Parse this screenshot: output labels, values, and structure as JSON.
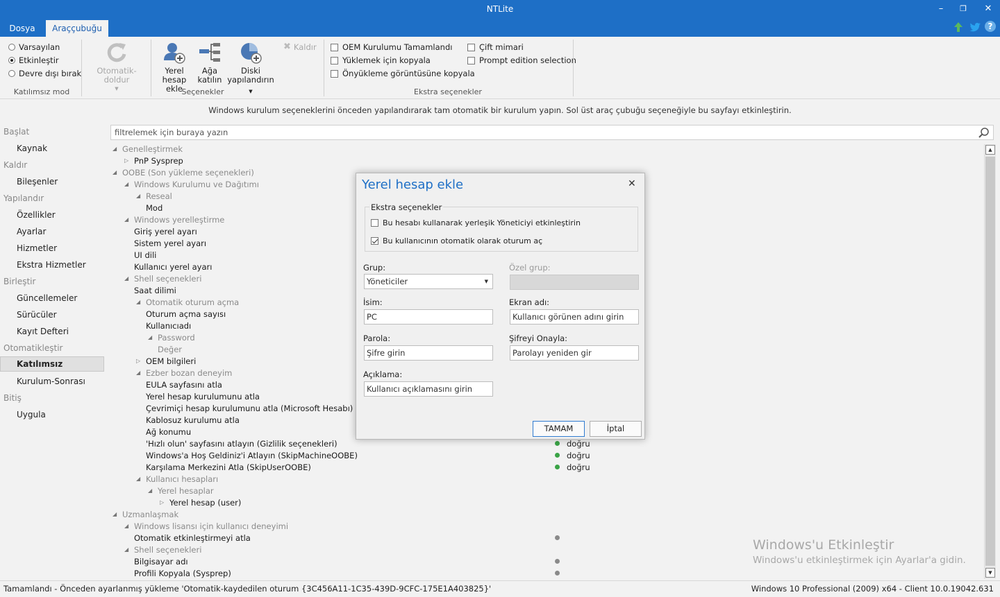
{
  "window": {
    "title": "NTLite",
    "min": "–",
    "max": "❐",
    "close": "✕"
  },
  "menu": {
    "tabs": [
      "Dosya",
      "Araççubuğu"
    ]
  },
  "ribbon": {
    "mode": {
      "options": [
        "Varsayılan",
        "Etkinleştir",
        "Devre dışı bırak"
      ],
      "selected": 1,
      "label": "Katılımsız mod"
    },
    "options": {
      "autorefresh": "Otomatik-doldur",
      "add_local_account": "Yerel hesap ekle",
      "add_local_account_l1": "Yerel",
      "add_local_account_l2": "hesap ekle",
      "join_network_l1": "Ağa",
      "join_network_l2": "katılın",
      "configure_disk_l1": "Diski",
      "configure_disk_l2": "yapılandırın",
      "remove": "Kaldır",
      "label": "Seçenekler"
    },
    "extra": {
      "items": [
        {
          "label": "OEM Kurulumu Tamamlandı",
          "checked": false
        },
        {
          "label": "Yüklemek için kopyala",
          "checked": false
        },
        {
          "label": "Önyükleme görüntüsüne kopyala",
          "checked": false
        },
        {
          "label": "Çift mimari",
          "checked": false
        },
        {
          "label": "Prompt edition selection",
          "checked": false
        }
      ],
      "label": "Ekstra seçenekler"
    },
    "right_icons": [
      "up-arrow-icon",
      "twitter-icon",
      "help-icon"
    ],
    "help": "?"
  },
  "info": "Windows kurulum seçeneklerini önceden yapılandırarak tam otomatik bir kurulum yapın. Sol üst araç çubuğu seçeneğiyle bu sayfayı etkinleştirin.",
  "sidebar": {
    "sections": [
      {
        "header": "Başlat",
        "items": [
          "Kaynak"
        ]
      },
      {
        "header": "Kaldır",
        "items": [
          "Bileşenler"
        ]
      },
      {
        "header": "Yapılandır",
        "items": [
          "Özellikler",
          "Ayarlar",
          "Hizmetler",
          "Ekstra Hizmetler"
        ]
      },
      {
        "header": "Birleştir",
        "items": [
          "Güncellemeler",
          "Sürücüler",
          "Kayıt Defteri"
        ]
      },
      {
        "header": "Otomatikleştir",
        "items": [
          "Katılımsız",
          "Kurulum-Sonrası"
        ]
      },
      {
        "header": "Bitiş",
        "items": [
          "Uygula"
        ]
      }
    ],
    "active": "Katılımsız"
  },
  "filter": {
    "placeholder": "filtrelemek için buraya yazın"
  },
  "tree": [
    {
      "label": "Genelleştirmek",
      "level": 0,
      "group": true,
      "arrow": "◢"
    },
    {
      "label": "PnP Sysprep",
      "level": 1,
      "group": false,
      "arrow": "▷"
    },
    {
      "label": "OOBE (Son yükleme seçenekleri)",
      "level": 0,
      "group": true,
      "arrow": "◢"
    },
    {
      "label": "Windows Kurulumu ve Dağıtımı",
      "level": 1,
      "group": true,
      "arrow": "◢"
    },
    {
      "label": "Reseal",
      "level": 2,
      "group": true,
      "arrow": "◢"
    },
    {
      "label": "Mod",
      "level": 2,
      "group": false
    },
    {
      "label": "Windows yerelleştirme",
      "level": 1,
      "group": true,
      "arrow": "◢"
    },
    {
      "label": "Giriş yerel ayarı",
      "level": 1,
      "group": false
    },
    {
      "label": "Sistem yerel ayarı",
      "level": 1,
      "group": false
    },
    {
      "label": "UI dili",
      "level": 1,
      "group": false
    },
    {
      "label": "Kullanıcı yerel ayarı",
      "level": 1,
      "group": false
    },
    {
      "label": "Shell seçenekleri",
      "level": 1,
      "group": true,
      "arrow": "◢"
    },
    {
      "label": "Saat dilimi",
      "level": 1,
      "group": false
    },
    {
      "label": "Otomatik oturum açma",
      "level": 2,
      "group": true,
      "arrow": "◢"
    },
    {
      "label": "Oturum açma sayısı",
      "level": 2,
      "group": false
    },
    {
      "label": "Kullanıcıadı",
      "level": 2,
      "group": false
    },
    {
      "label": "Password",
      "level": 3,
      "group": true,
      "arrow": "◢"
    },
    {
      "label": "Değer",
      "level": 3,
      "group": true
    },
    {
      "label": "OEM bilgileri",
      "level": 2,
      "group": false,
      "arrow": "▷"
    },
    {
      "label": "Ezber bozan deneyim",
      "level": 2,
      "group": true,
      "arrow": "◢"
    },
    {
      "label": "EULA sayfasını atla",
      "level": 2,
      "group": false
    },
    {
      "label": "Yerel hesap kurulumunu atla",
      "level": 2,
      "group": false
    },
    {
      "label": "Çevrimiçi hesap kurulumunu atla (Microsoft Hesabı)",
      "level": 2,
      "group": false
    },
    {
      "label": "Kablosuz kurulumu atla",
      "level": 2,
      "group": false
    },
    {
      "label": "Ağ konumu",
      "level": 2,
      "group": false
    },
    {
      "label": "'Hızlı olun' sayfasını atlayın (Gizlilik seçenekleri)",
      "level": 2,
      "group": false,
      "value": "doğru",
      "dot": "#3aa346"
    },
    {
      "label": "Windows'a Hoş Geldiniz'i Atlayın (SkipMachineOOBE)",
      "level": 2,
      "group": false,
      "value": "doğru",
      "dot": "#3aa346"
    },
    {
      "label": "Karşılama Merkezini Atla (SkipUserOOBE)",
      "level": 2,
      "group": false,
      "value": "doğru",
      "dot": "#3aa346"
    },
    {
      "label": "Kullanıcı hesapları",
      "level": 2,
      "group": true,
      "arrow": "◢"
    },
    {
      "label": "Yerel hesaplar",
      "level": 3,
      "group": true,
      "arrow": "◢"
    },
    {
      "label": "Yerel hesap (user)",
      "level": 4,
      "group": false,
      "arrow": "▷"
    },
    {
      "label": "Uzmanlaşmak",
      "level": 0,
      "group": true,
      "arrow": "◢"
    },
    {
      "label": "Windows lisansı için kullanıcı deneyimi",
      "level": 1,
      "group": true,
      "arrow": "◢"
    },
    {
      "label": "Otomatik etkinleştirmeyi atla",
      "level": 1,
      "group": false,
      "value": "",
      "dot": "#8a8a8a"
    },
    {
      "label": "Shell seçenekleri",
      "level": 1,
      "group": true,
      "arrow": "◢"
    },
    {
      "label": "Bilgisayar adı",
      "level": 1,
      "group": false,
      "value": "",
      "dot": "#8a8a8a"
    },
    {
      "label": "Profili Kopyala (Sysprep)",
      "level": 1,
      "group": false,
      "value": "",
      "dot": "#8a8a8a"
    }
  ],
  "watermark": {
    "line1": "Windows'u Etkinleştir",
    "line2": "Windows'u etkinleştirmek için Ayarlar'a gidin."
  },
  "status": {
    "left": "Tamamlandı - Önceden ayarlanmış yükleme 'Otomatik-kaydedilen oturum {3C456A11-1C35-439D-9CFC-175E1A403825}'",
    "right": "Windows 10 Professional (2009) x64 - Client 10.0.19042.631"
  },
  "dialog": {
    "title": "Yerel hesap ekle",
    "close": "✕",
    "group_title": "Ekstra seçenekler",
    "enable_admin": {
      "label": "Bu hesabı kullanarak yerleşik Yöneticiyi etkinleştirin",
      "checked": false
    },
    "auto_logon": {
      "label": "Bu kullanıcının otomatik olarak oturum aç",
      "checked": true
    },
    "group_label": "Grup:",
    "group_value": "Yöneticiler",
    "custom_group_label": "Özel grup:",
    "name_label": "İsim:",
    "name_value": "PC",
    "display_label": "Ekran adı:",
    "display_placeholder": "Kullanıcı görünen adını girin",
    "password_label": "Parola:",
    "password_placeholder": "Şifre girin",
    "confirm_label": "Şifreyi Onayla:",
    "confirm_placeholder": "Parolayı yeniden gir",
    "desc_label": "Açıklama:",
    "desc_placeholder": "Kullanıcı açıklamasını girin",
    "ok": "TAMAM",
    "cancel": "İptal"
  }
}
